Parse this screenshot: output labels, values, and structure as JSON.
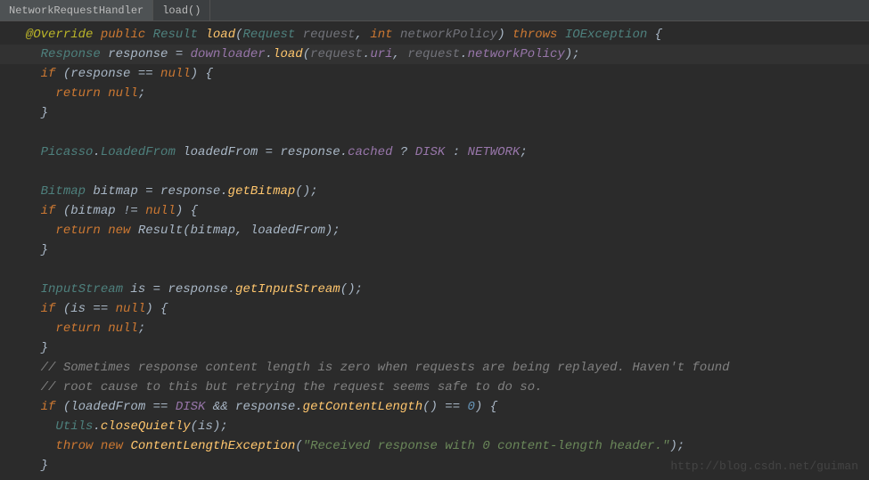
{
  "breadcrumb": {
    "class_name": "NetworkRequestHandler",
    "method_name": "load()"
  },
  "code": {
    "lines": [
      {
        "indent": 1,
        "highlight": false,
        "tokens": [
          {
            "cls": "annotation",
            "t": "@Override"
          },
          {
            "cls": "punct",
            "t": " "
          },
          {
            "cls": "kw",
            "t": "public"
          },
          {
            "cls": "punct",
            "t": " "
          },
          {
            "cls": "type",
            "t": "Result"
          },
          {
            "cls": "punct",
            "t": " "
          },
          {
            "cls": "method",
            "t": "load"
          },
          {
            "cls": "punct",
            "t": "("
          },
          {
            "cls": "type",
            "t": "Request"
          },
          {
            "cls": "punct",
            "t": " "
          },
          {
            "cls": "param",
            "t": "request"
          },
          {
            "cls": "punct",
            "t": ", "
          },
          {
            "cls": "kw",
            "t": "int"
          },
          {
            "cls": "punct",
            "t": " "
          },
          {
            "cls": "param",
            "t": "networkPolicy"
          },
          {
            "cls": "punct",
            "t": ") "
          },
          {
            "cls": "kw",
            "t": "throws"
          },
          {
            "cls": "punct",
            "t": " "
          },
          {
            "cls": "exception",
            "t": "IOException"
          },
          {
            "cls": "punct",
            "t": " {"
          }
        ]
      },
      {
        "indent": 2,
        "highlight": true,
        "tokens": [
          {
            "cls": "type",
            "t": "Response"
          },
          {
            "cls": "punct",
            "t": " response = "
          },
          {
            "cls": "field",
            "t": "downloader"
          },
          {
            "cls": "punct",
            "t": "."
          },
          {
            "cls": "method",
            "t": "load"
          },
          {
            "cls": "punct",
            "t": "("
          },
          {
            "cls": "param",
            "t": "request"
          },
          {
            "cls": "punct",
            "t": "."
          },
          {
            "cls": "field",
            "t": "uri"
          },
          {
            "cls": "punct",
            "t": ", "
          },
          {
            "cls": "param",
            "t": "request"
          },
          {
            "cls": "punct",
            "t": "."
          },
          {
            "cls": "field",
            "t": "networkPolicy"
          },
          {
            "cls": "punct",
            "t": ");"
          }
        ]
      },
      {
        "indent": 2,
        "highlight": false,
        "tokens": [
          {
            "cls": "kw",
            "t": "if"
          },
          {
            "cls": "punct",
            "t": " (response == "
          },
          {
            "cls": "kw",
            "t": "null"
          },
          {
            "cls": "punct",
            "t": ") {"
          }
        ]
      },
      {
        "indent": 3,
        "highlight": false,
        "tokens": [
          {
            "cls": "kw",
            "t": "return null"
          },
          {
            "cls": "punct",
            "t": ";"
          }
        ]
      },
      {
        "indent": 2,
        "highlight": false,
        "tokens": [
          {
            "cls": "punct",
            "t": "}"
          }
        ]
      },
      {
        "indent": 2,
        "highlight": false,
        "tokens": []
      },
      {
        "indent": 2,
        "highlight": false,
        "tokens": [
          {
            "cls": "type",
            "t": "Picasso"
          },
          {
            "cls": "punct",
            "t": "."
          },
          {
            "cls": "type",
            "t": "LoadedFrom"
          },
          {
            "cls": "punct",
            "t": " loadedFrom = response."
          },
          {
            "cls": "field",
            "t": "cached"
          },
          {
            "cls": "punct",
            "t": " ? "
          },
          {
            "cls": "static-field",
            "t": "DISK"
          },
          {
            "cls": "punct",
            "t": " : "
          },
          {
            "cls": "static-field",
            "t": "NETWORK"
          },
          {
            "cls": "punct",
            "t": ";"
          }
        ]
      },
      {
        "indent": 2,
        "highlight": false,
        "tokens": []
      },
      {
        "indent": 2,
        "highlight": false,
        "tokens": [
          {
            "cls": "type",
            "t": "Bitmap"
          },
          {
            "cls": "punct",
            "t": " bitmap = response."
          },
          {
            "cls": "method",
            "t": "getBitmap"
          },
          {
            "cls": "punct",
            "t": "();"
          }
        ]
      },
      {
        "indent": 2,
        "highlight": false,
        "tokens": [
          {
            "cls": "kw",
            "t": "if"
          },
          {
            "cls": "punct",
            "t": " (bitmap != "
          },
          {
            "cls": "kw",
            "t": "null"
          },
          {
            "cls": "punct",
            "t": ") {"
          }
        ]
      },
      {
        "indent": 3,
        "highlight": false,
        "tokens": [
          {
            "cls": "kw",
            "t": "return new"
          },
          {
            "cls": "punct",
            "t": " Result(bitmap, loadedFrom);"
          }
        ]
      },
      {
        "indent": 2,
        "highlight": false,
        "tokens": [
          {
            "cls": "punct",
            "t": "}"
          }
        ]
      },
      {
        "indent": 2,
        "highlight": false,
        "tokens": []
      },
      {
        "indent": 2,
        "highlight": false,
        "tokens": [
          {
            "cls": "type",
            "t": "InputStream"
          },
          {
            "cls": "punct",
            "t": " is = response."
          },
          {
            "cls": "method",
            "t": "getInputStream"
          },
          {
            "cls": "punct",
            "t": "();"
          }
        ]
      },
      {
        "indent": 2,
        "highlight": false,
        "tokens": [
          {
            "cls": "kw",
            "t": "if"
          },
          {
            "cls": "punct",
            "t": " (is == "
          },
          {
            "cls": "kw",
            "t": "null"
          },
          {
            "cls": "punct",
            "t": ") {"
          }
        ]
      },
      {
        "indent": 3,
        "highlight": false,
        "tokens": [
          {
            "cls": "kw",
            "t": "return null"
          },
          {
            "cls": "punct",
            "t": ";"
          }
        ]
      },
      {
        "indent": 2,
        "highlight": false,
        "tokens": [
          {
            "cls": "punct",
            "t": "}"
          }
        ]
      },
      {
        "indent": 2,
        "highlight": false,
        "tokens": [
          {
            "cls": "comment",
            "t": "// Sometimes response content length is zero when requests are being replayed. Haven't found"
          }
        ]
      },
      {
        "indent": 2,
        "highlight": false,
        "tokens": [
          {
            "cls": "comment",
            "t": "// root cause to this but retrying the request seems safe to do so."
          }
        ]
      },
      {
        "indent": 2,
        "highlight": false,
        "tokens": [
          {
            "cls": "kw",
            "t": "if"
          },
          {
            "cls": "punct",
            "t": " (loadedFrom == "
          },
          {
            "cls": "static-field",
            "t": "DISK"
          },
          {
            "cls": "punct",
            "t": " && response."
          },
          {
            "cls": "method",
            "t": "getContentLength"
          },
          {
            "cls": "punct",
            "t": "() == "
          },
          {
            "cls": "num",
            "t": "0"
          },
          {
            "cls": "punct",
            "t": ") {"
          }
        ]
      },
      {
        "indent": 3,
        "highlight": false,
        "tokens": [
          {
            "cls": "type",
            "t": "Utils"
          },
          {
            "cls": "punct",
            "t": "."
          },
          {
            "cls": "method",
            "t": "closeQuietly"
          },
          {
            "cls": "punct",
            "t": "(is);"
          }
        ]
      },
      {
        "indent": 3,
        "highlight": false,
        "tokens": [
          {
            "cls": "kw",
            "t": "throw new"
          },
          {
            "cls": "punct",
            "t": " "
          },
          {
            "cls": "method",
            "t": "ContentLengthException"
          },
          {
            "cls": "punct",
            "t": "("
          },
          {
            "cls": "str",
            "t": "\"Received response with 0 content-length header.\""
          },
          {
            "cls": "punct",
            "t": ");"
          }
        ]
      },
      {
        "indent": 2,
        "highlight": false,
        "tokens": [
          {
            "cls": "punct",
            "t": "}"
          }
        ]
      }
    ]
  },
  "watermark": "http://blog.csdn.net/guiman"
}
